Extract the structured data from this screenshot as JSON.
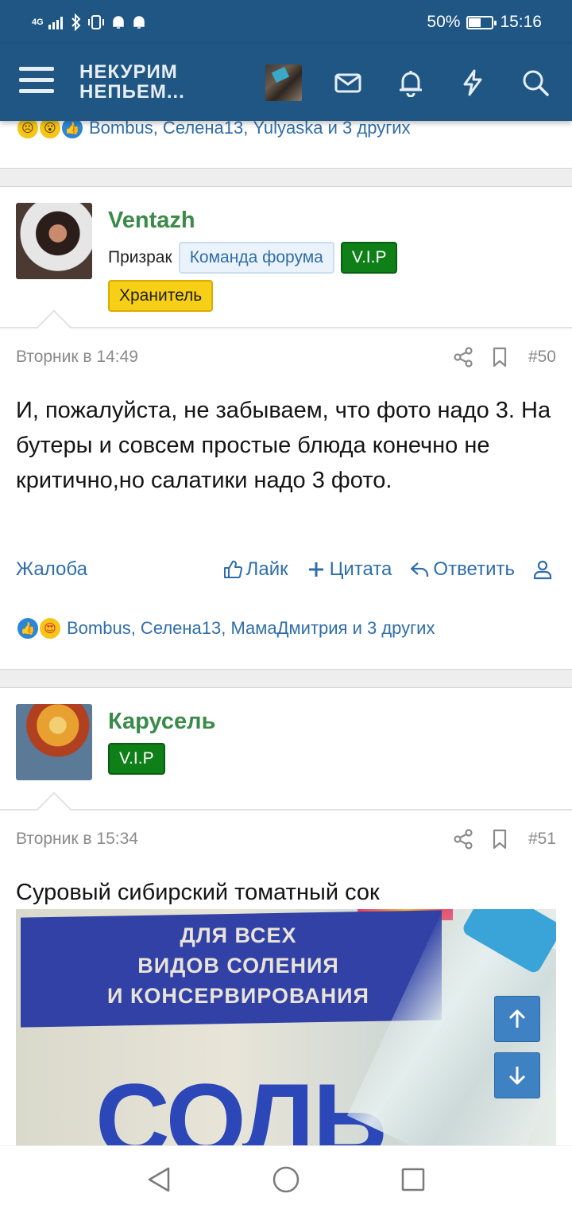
{
  "status_bar": {
    "network": "4G",
    "battery_percent_text": "50%",
    "battery_level": 0.5,
    "time": "15:16"
  },
  "header": {
    "logo_line1": "НЕКУРИМ",
    "logo_line2": "НЕПЬЕМ..."
  },
  "previous_post": {
    "reactions": "Bombus, Селена13, Yulyaska и 3 других"
  },
  "posts": [
    {
      "username": "Ventazh",
      "user_title": "Призрак",
      "badges": [
        "Команда форума",
        "V.I.P",
        "Хранитель"
      ],
      "date": "Вторник в 14:49",
      "number": "#50",
      "body": "И, пожалуйста, не забываем, что фото надо 3. На бутеры и совсем простые блюда конечно не критично,но салатики надо 3 фото.",
      "actions": {
        "report": "Жалоба",
        "like": "Лайк",
        "quote": "Цитата",
        "reply": "Ответить"
      },
      "reactions": "Bombus, Селена13, МамаДмитрия и 3 других"
    },
    {
      "username": "Карусель",
      "badges": [
        "V.I.P"
      ],
      "date": "Вторник в 15:34",
      "number": "#51",
      "body": "Суровый сибирский томатный сок",
      "image_text": {
        "line1": "ДЛЯ ВСЕХ",
        "line2": "ВИДОВ СОЛЕНИЯ",
        "line3": "И КОНСЕРВИРОВАНИЯ",
        "big": "СОЛЬ"
      }
    }
  ],
  "colors": {
    "header_bg": "#1f5683",
    "link": "#2f6ea8",
    "username": "#3a8a4a",
    "vip_badge": "#0f7f17",
    "keeper_badge": "#f7cf17"
  }
}
